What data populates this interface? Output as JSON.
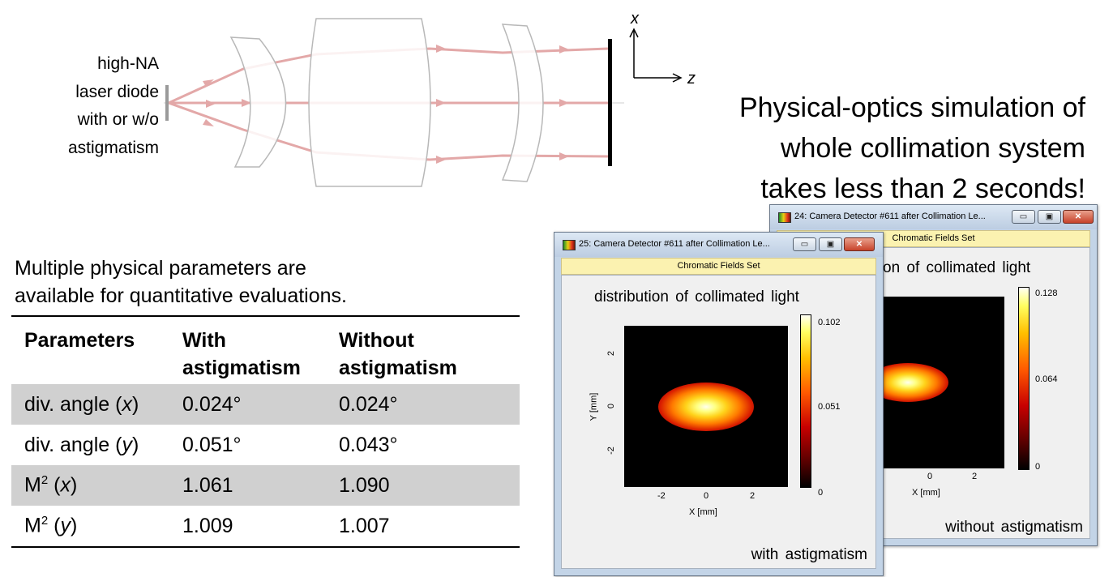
{
  "diagram": {
    "source_label_lines": [
      "high-NA",
      "laser diode",
      "with or w/o",
      "astigmatism"
    ],
    "axis_x": "x",
    "axis_z": "z"
  },
  "headline_lines": [
    "Physical-optics simulation of",
    "whole collimation system",
    "takes less than 2 seconds!"
  ],
  "intro_lines": [
    "Multiple physical parameters are",
    "available for quantitative evaluations."
  ],
  "table": {
    "headers": [
      "Parameters",
      "With astigmatism",
      "Without astigmatism"
    ],
    "rows": [
      {
        "param_text": "div. angle (",
        "param_var": "x",
        "param_close": ")",
        "with": "0.024°",
        "without": "0.024°"
      },
      {
        "param_text": "div. angle (",
        "param_var": "y",
        "param_close": ")",
        "with": "0.051°",
        "without": "0.043°"
      },
      {
        "param_text": "M",
        "param_sup": "2",
        "param_open": " (",
        "param_var": "x",
        "param_close": ")",
        "with": "1.061",
        "without": "1.090"
      },
      {
        "param_text": "M",
        "param_sup": "2",
        "param_open": " (",
        "param_var": "y",
        "param_close": ")",
        "with": "1.009",
        "without": "1.007"
      }
    ]
  },
  "windows": {
    "back": {
      "title": "24: Camera Detector #611 after Collimation Le...",
      "fields_bar": "Chromatic Fields Set",
      "plot_title_visible": "on  of collimated  light",
      "corner_label": "without  astigmatism",
      "colorbar_ticks": [
        "0.128",
        "0.064",
        "0"
      ],
      "x_ticks": [
        "0",
        "2"
      ],
      "x_axis_label": "X [mm]"
    },
    "front": {
      "title": "25: Camera Detector #611 after Collimation Le...",
      "fields_bar": "Chromatic Fields Set",
      "plot_title": "distribution  of collimated  light",
      "corner_label": "with  astigmatism",
      "colorbar_ticks": [
        "0.102",
        "0.051",
        "0"
      ],
      "x_ticks": [
        "-2",
        "0",
        "2"
      ],
      "y_ticks": [
        "2",
        "0",
        "-2"
      ],
      "x_axis_label": "X [mm]",
      "y_axis_label": "Y [mm]"
    },
    "minimize_glyph": "▭",
    "maximize_glyph": "▣",
    "close_glyph": "✕"
  },
  "colors": {
    "ray": "#e3a8a8",
    "lens_stroke": "#b8b8b8",
    "window_frame": "#c3d4e7",
    "fields_bar": "#fbf2b0",
    "table_shade": "#d0d0d0"
  }
}
